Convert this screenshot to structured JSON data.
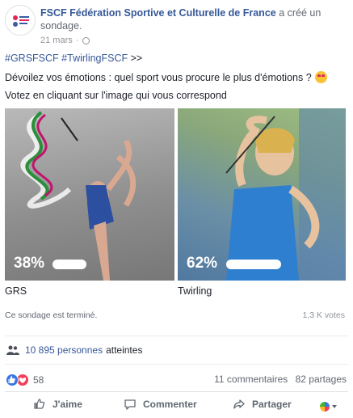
{
  "header": {
    "page_name": "FSCF Fédération Sportive et Culturelle de France",
    "action": "a créé un sondage.",
    "date": "21 mars",
    "separator": "·",
    "logo_text": "Fédération Sportive et Culturelle"
  },
  "post": {
    "hashtag_1": "#GRSFSCF",
    "hashtag_2": "#TwirlingFSCF",
    "hashtag_suffix": ">>",
    "question": "Dévoilez vos émotions : quel sport vous procure le plus d'émotions ?",
    "instruction": "Votez en cliquant sur l'image qui vous correspond"
  },
  "poll": {
    "options": [
      {
        "label": "GRS",
        "percent_text": "38%",
        "percent": 38
      },
      {
        "label": "Twirling",
        "percent_text": "62%",
        "percent": 62
      }
    ],
    "status": "Ce sondage est terminé.",
    "votes": "1,3 K votes"
  },
  "reach": {
    "count": "10 895 personnes",
    "suffix": "atteintes"
  },
  "engagement": {
    "reactions_count": "58",
    "comments": "11 commentaires",
    "shares": "82 partages"
  },
  "actions": {
    "like": "J'aime",
    "comment": "Commenter",
    "share": "Partager"
  },
  "icons": [
    "logo-icon",
    "globe-icon",
    "heart-eyes-emoji-icon",
    "people-icon",
    "like-reaction-icon",
    "love-reaction-icon",
    "thumbs-up-icon",
    "comment-icon",
    "share-icon",
    "audience-selector-icon"
  ],
  "colors": {
    "link": "#365899",
    "text": "#1d2129",
    "muted": "#90949c",
    "like": "#3578e5",
    "love": "#f33e58"
  }
}
